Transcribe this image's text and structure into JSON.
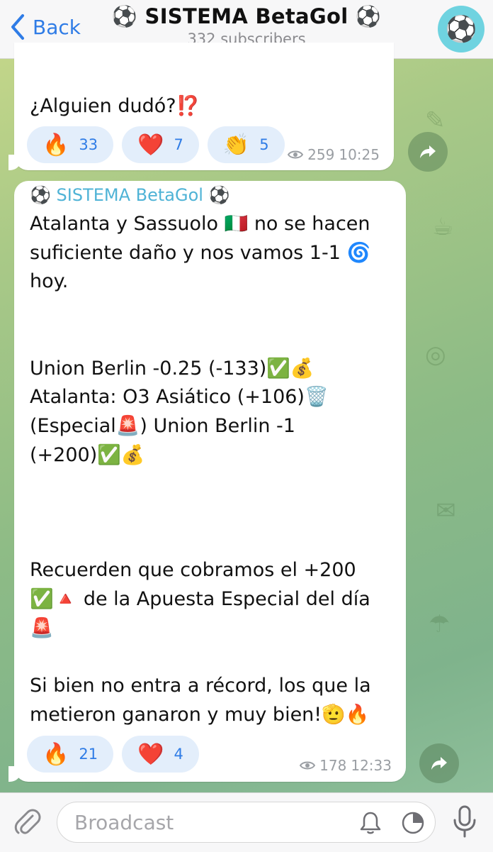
{
  "header": {
    "back_label": "Back",
    "title": "⚽ SISTEMA BetaGol ⚽",
    "subtitle": "332 subscribers",
    "avatar_emoji": "⚽"
  },
  "messages": [
    {
      "text": "¿Alguien dudó?⁉️",
      "reactions": [
        {
          "emoji": "🔥",
          "count": "33"
        },
        {
          "emoji": "❤️",
          "count": "7"
        },
        {
          "emoji": "👏",
          "count": "5"
        }
      ],
      "views": "259",
      "time": "10:25"
    },
    {
      "sender": "⚽ SISTEMA BetaGol ⚽",
      "text": "Atalanta y Sassuolo 🇮🇹 no se hacen\nsuficiente daño y nos vamos 1-1 🌀\nhoy.\n\n\nUnion Berlin -0.25 (-133)✅💰\nAtalanta: O3 Asiático (+106)🗑️\n(Especial🚨) Union Berlin -1\n(+200)✅💰\n\n\n\nRecuerden que cobramos el +200\n✅🔺 de la Apuesta Especial del día\n🚨\n\nSi bien no entra a récord, los que la\nmetieron ganaron y muy bien!🫡🔥",
      "reactions": [
        {
          "emoji": "🔥",
          "count": "21"
        },
        {
          "emoji": "❤️",
          "count": "4"
        }
      ],
      "views": "178",
      "time": "12:33"
    }
  ],
  "input": {
    "placeholder": "Broadcast"
  },
  "colors": {
    "accent": "#2f7ce6",
    "sender": "#4fb3d6",
    "reaction_bg": "#e3eefb"
  },
  "icons": [
    "back-chevron-icon",
    "eye-icon",
    "share-icon",
    "paperclip-icon",
    "bell-icon",
    "timer-icon",
    "microphone-icon"
  ]
}
